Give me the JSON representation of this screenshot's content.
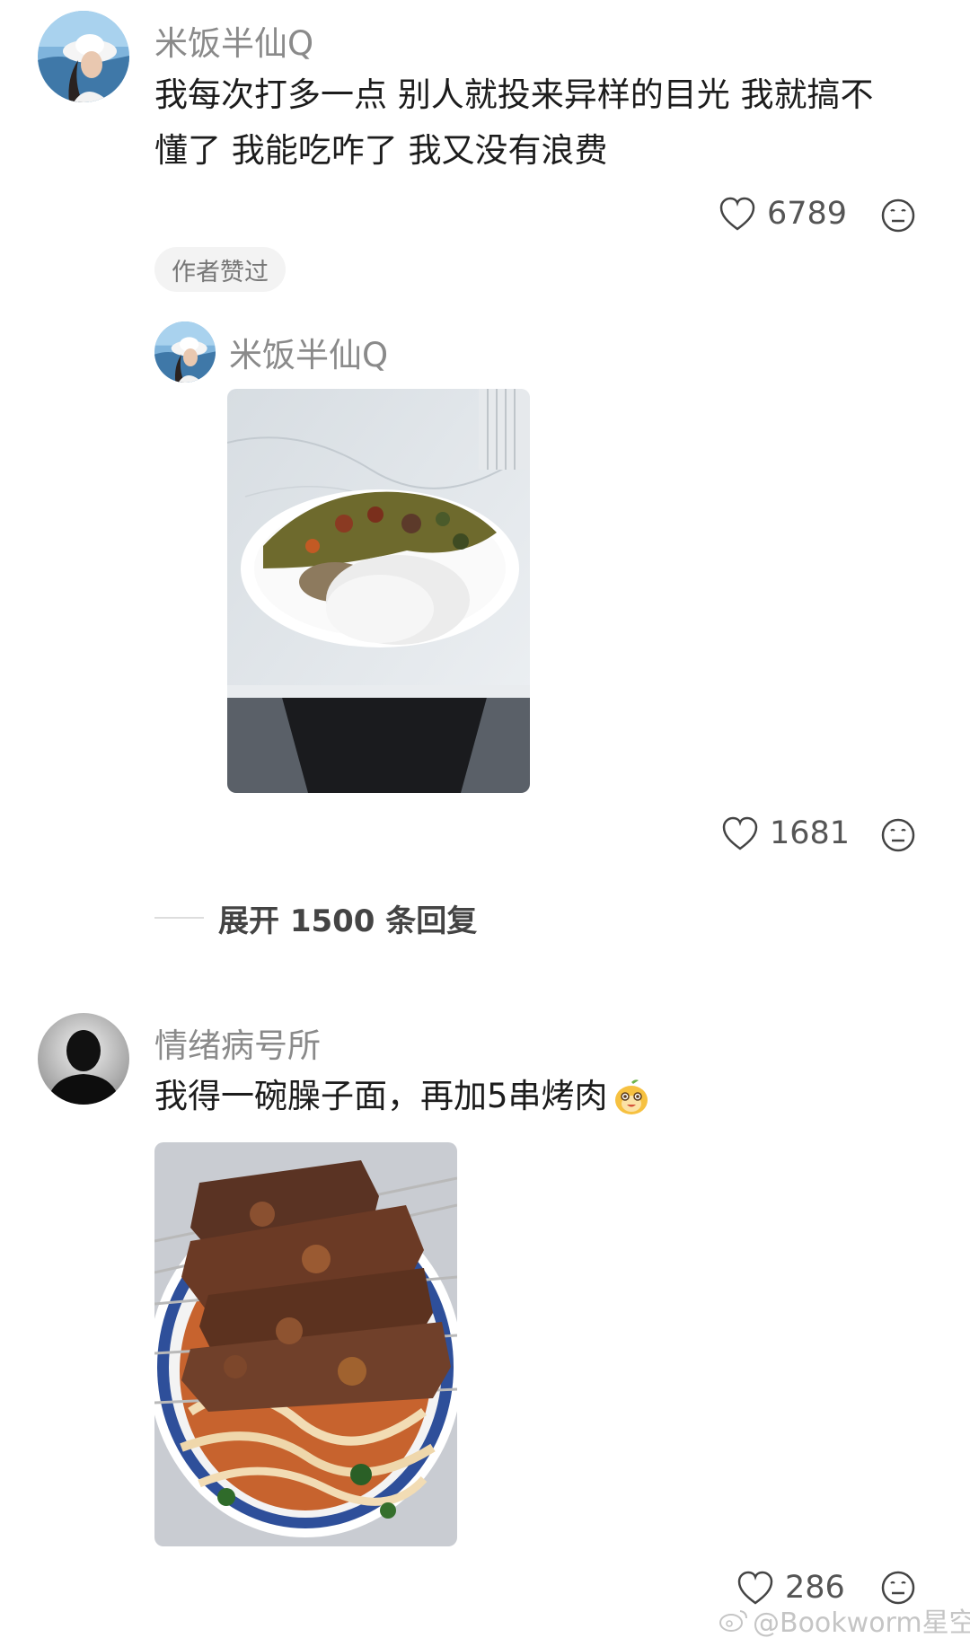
{
  "comment1": {
    "username": "米饭半仙Q",
    "text_line1": "我每次打多一点 别人就投来异样的目光 我就搞不",
    "text_line2": "懂了 我能吃咋了 我又没有浪费",
    "likes": "6789",
    "badge": "作者赞过"
  },
  "reply1": {
    "username": "米饭半仙Q",
    "likes": "1681"
  },
  "expand": {
    "label": "展开 1500 条回复"
  },
  "comment2": {
    "username": "情绪病号所",
    "text": "我得一碗臊子面，再加5串烤肉",
    "likes": "286"
  },
  "watermark": {
    "text": "@Bookworm星空"
  }
}
